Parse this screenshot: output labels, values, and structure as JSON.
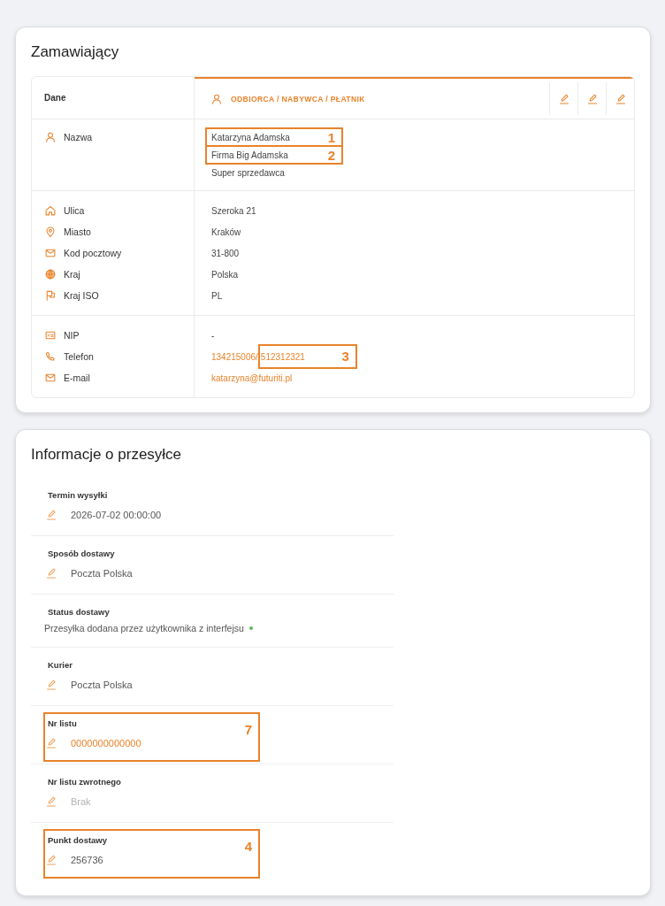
{
  "customer": {
    "title": "Zamawiający",
    "column_label": "Dane",
    "tab": {
      "label": "ODBIORCA / NABYWCA / PŁATNIK",
      "selected": true
    },
    "groups": [
      {
        "labels": [
          {
            "kind": "name",
            "text": "Nazwa"
          }
        ],
        "values": [
          {
            "text": "Katarzyna Adamska",
            "link": false,
            "callout": "1"
          },
          {
            "text": "Firma Big Adamska",
            "link": false,
            "callout": "2"
          },
          {
            "text": "Super sprzedawca",
            "link": false
          }
        ]
      },
      {
        "labels": [
          {
            "kind": "street",
            "text": "Ulica"
          },
          {
            "kind": "city",
            "text": "Miasto"
          },
          {
            "kind": "postal",
            "text": "Kod pocztowy"
          },
          {
            "kind": "country",
            "text": "Kraj"
          },
          {
            "kind": "iso",
            "text": "Kraj ISO"
          }
        ],
        "values": [
          {
            "text": "Szeroka 21",
            "link": false
          },
          {
            "text": "Kraków",
            "link": false
          },
          {
            "text": "31-800",
            "link": false
          },
          {
            "text": "Polska",
            "link": false
          },
          {
            "text": "PL",
            "link": false
          }
        ]
      },
      {
        "labels": [
          {
            "kind": "nip",
            "text": "NIP"
          },
          {
            "kind": "phone",
            "text": "Telefon"
          },
          {
            "kind": "email",
            "text": "E-mail"
          }
        ],
        "values": [
          {
            "text": "-",
            "link": false
          },
          {
            "parts": [
              {
                "text": "134215006/",
                "link": true
              },
              {
                "text": "512312321",
                "link": true,
                "callout": "3"
              }
            ]
          },
          {
            "text": "katarzyna@futuriti.pl",
            "link": true
          }
        ]
      }
    ]
  },
  "shipment": {
    "title": "Informacje o przesyłce",
    "fields": [
      {
        "kind": "edit",
        "label": "Termin wysyłki",
        "value": "2026-07-02 00:00:00",
        "link": false
      },
      {
        "kind": "edit",
        "label": "Sposób dostawy",
        "value": "Poczta Polska",
        "link": false
      },
      {
        "kind": "status",
        "label": "Status dostawy",
        "value": "Przesyłka dodana przez użytkownika z interfejsu",
        "color": "#5cb85c"
      },
      {
        "kind": "edit",
        "label": "Kurier",
        "value": "Poczta Polska",
        "link": false
      },
      {
        "kind": "edit",
        "label": "Nr listu",
        "value": "0000000000000",
        "link": true,
        "callout": "7"
      },
      {
        "kind": "edit",
        "label": "Nr listu zwrotnego",
        "placeholder": "Brak",
        "link": false
      },
      {
        "kind": "edit",
        "label": "Punkt dostawy",
        "value": "256736",
        "link": false,
        "callout": "4"
      }
    ]
  }
}
